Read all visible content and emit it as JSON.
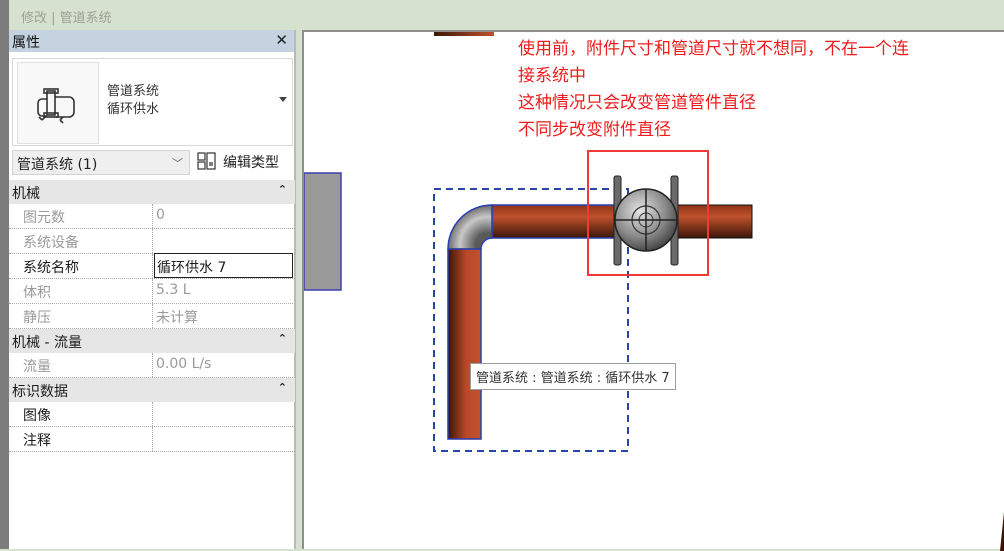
{
  "ribbon": {
    "context_title": "修改 | 管道系统"
  },
  "properties": {
    "title": "属性",
    "close_label": "✕",
    "type_selector": {
      "family": "管道系统",
      "type": "循环供水",
      "icon": "piping-system-icon"
    },
    "filter": {
      "selected": "管道系统 (1)"
    },
    "edit_type_label": "编辑类型",
    "sections": [
      {
        "name": "机械",
        "rows": [
          {
            "key": "图元数",
            "value": "0"
          },
          {
            "key": "系统设备",
            "value": ""
          },
          {
            "key": "系统名称",
            "value": "循环供水 7"
          },
          {
            "key": "体积",
            "value": "5.3 L"
          },
          {
            "key": "静压",
            "value": "未计算"
          }
        ]
      },
      {
        "name": "机械 - 流量",
        "rows": [
          {
            "key": "流量",
            "value": "0.00 L/s"
          }
        ]
      },
      {
        "name": "标识数据",
        "rows": [
          {
            "key": "图像",
            "value": ""
          },
          {
            "key": "注释",
            "value": ""
          }
        ]
      }
    ],
    "collapse_glyph": "⌃"
  },
  "canvas": {
    "annotation_lines": [
      "使用前，附件尺寸和管道尺寸就不想同，不在一个连",
      "接系统中",
      "这种情况只会改变管道管件直径",
      "不同步改变附件直径"
    ],
    "tooltip": "管道系统 : 管道系统 : 循环供水 7",
    "colors": {
      "pipe": "#b9492a",
      "highlight": "#f03a3a",
      "selection": "#2a3fb0"
    }
  }
}
